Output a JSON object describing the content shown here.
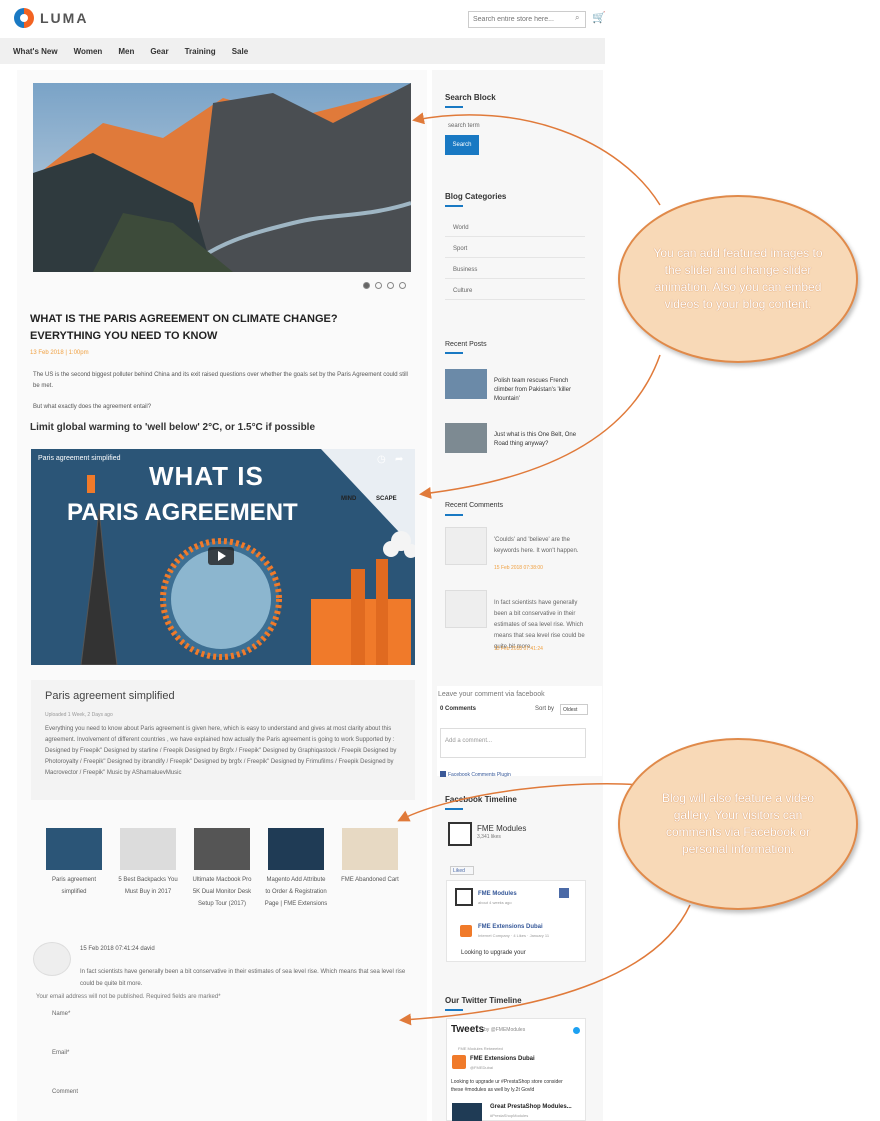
{
  "header": {
    "brand": "LUMA",
    "search_placeholder": "Search entire store here...",
    "nav": [
      "What's New",
      "Women",
      "Men",
      "Gear",
      "Training",
      "Sale"
    ]
  },
  "post": {
    "title": "WHAT IS THE PARIS AGREEMENT ON CLIMATE CHANGE? EVERYTHING YOU NEED TO KNOW",
    "date": "13 Feb 2018 | 1:00pm",
    "p1": "The US is the second biggest polluter behind China and its exit raised questions over whether the goals set by the Paris Agreement could still be met.",
    "p2": "But what exactly does the agreement entail?",
    "subheading": "Limit global warming to 'well below' 2°C, or 1.5°C if possible",
    "video": {
      "overlay_title": "Paris agreement simplified",
      "big_line1": "WHAT IS",
      "big_line2": "PARIS AGREEMENT",
      "brand_left": "MIND",
      "brand_right": "SCAPE"
    },
    "video_card": {
      "title": "Paris agreement simplified",
      "meta": "Uploaded 1 Week, 2 Days ago",
      "desc": "Everything you need to know about Paris agreement is given here, which is easy to understand and gives at most clarity about this agreement. Involvement of different countries , we have explained how actually the Paris agreement is going to work Supported by : Designed by Freepik\" Designed by starline / Freepik Designed by Brgfx / Freepik\" Designed by Graphiqastock / Freepik Designed by Photoroyalty / Freepik\" Designed by ibrandify / Freepik\" Designed by brgfx / Freepik\" Designed by Frimufilms / Freepik Designed by Macrovector / Freepik\" Music by AShamaluevMusic"
    },
    "gallery": [
      {
        "caption": "Paris agreement simplified"
      },
      {
        "caption": "5 Best Backpacks You Must Buy in 2017"
      },
      {
        "caption": "Ultimate Macbook Pro 5K Dual Monitor Desk Setup Tour (2017)"
      },
      {
        "caption": "Magento Add Attribute to Order & Registration Page | FME Extensions"
      },
      {
        "caption": "FME Abandoned Cart"
      }
    ],
    "comment": {
      "meta": "15 Feb 2018 07:41:24  david",
      "text": "In fact scientists have generally been a bit conservative in their estimates of sea level rise. Which means that sea level rise could be quite bit more."
    },
    "form": {
      "note": "Your email address will not be published. Required fields are marked*",
      "name_label": "Name*",
      "email_label": "Email*",
      "comment_label": "Comment"
    }
  },
  "sidebar": {
    "search_title": "Search Block",
    "search_placeholder": "search term",
    "search_button": "Search",
    "categories_title": "Blog Categories",
    "categories": [
      "World",
      "Sport",
      "Business",
      "Culture"
    ],
    "recent_posts_title": "Recent Posts",
    "recent_posts": [
      {
        "title": "Polish team rescues French climber from Pakistan's 'killer Mountain'"
      },
      {
        "title": "Just what is this One Belt, One Road thing anyway?"
      }
    ],
    "recent_comments_title": "Recent Comments",
    "recent_comments": [
      {
        "text": "'Coulds' and 'believe' are the keywords here. It won't happen.",
        "date": "15 Feb 2018 07:38:00"
      },
      {
        "text": "In fact scientists have generally been a bit conservative in their estimates of sea level rise. Which means that sea level rise could be quite bit more.",
        "date": "15 Feb 2018 07:41:24"
      }
    ],
    "fb_comments": {
      "prompt": "Leave your comment via facebook",
      "count": "0 Comments",
      "sort_label": "Sort by",
      "sort_value": "Oldest",
      "input_placeholder": "Add a comment...",
      "plugin": "Facebook Comments Plugin"
    },
    "fb_timeline_title": "Facebook Timeline",
    "fb_page": {
      "name": "FME Modules",
      "likes": "3,341 likes",
      "liked": "Liked"
    },
    "fb_posts": [
      {
        "name": "FME Modules",
        "sub": "about 4 weeks ago"
      },
      {
        "name": "FME Extensions Dubai",
        "sub": "Internet Company · 4 Likes · January 11",
        "text": "Looking to upgrade your"
      }
    ],
    "twitter_title": "Our Twitter Timeline",
    "tweets_label": "Tweets",
    "tweets_by": "by @FMEModules",
    "tweets": [
      {
        "retweet": "FME Modules Retweeted",
        "name": "FME Extensions Dubai",
        "handle": "@FMEDubai",
        "text": "Looking to upgrade ur #PrestaShop store consider these #modules as well by ly.2t Govld"
      },
      {
        "name": "Great PrestaShop Modules...",
        "handle": "#PrestaShopModules"
      }
    ]
  },
  "callouts": {
    "cloud1": "You can add featured images to the slider and change slider animation. Also you can embed videos to your blog content.",
    "cloud2": "Blog will also feature a video gallery. Your visitors can comments via Facebook or personal information."
  },
  "colors": {
    "accent": "#1979c3",
    "orange": "#f26322",
    "cloud_fill": "#f8d9b7",
    "cloud_border": "#e08a4a",
    "date": "#f0a040"
  }
}
